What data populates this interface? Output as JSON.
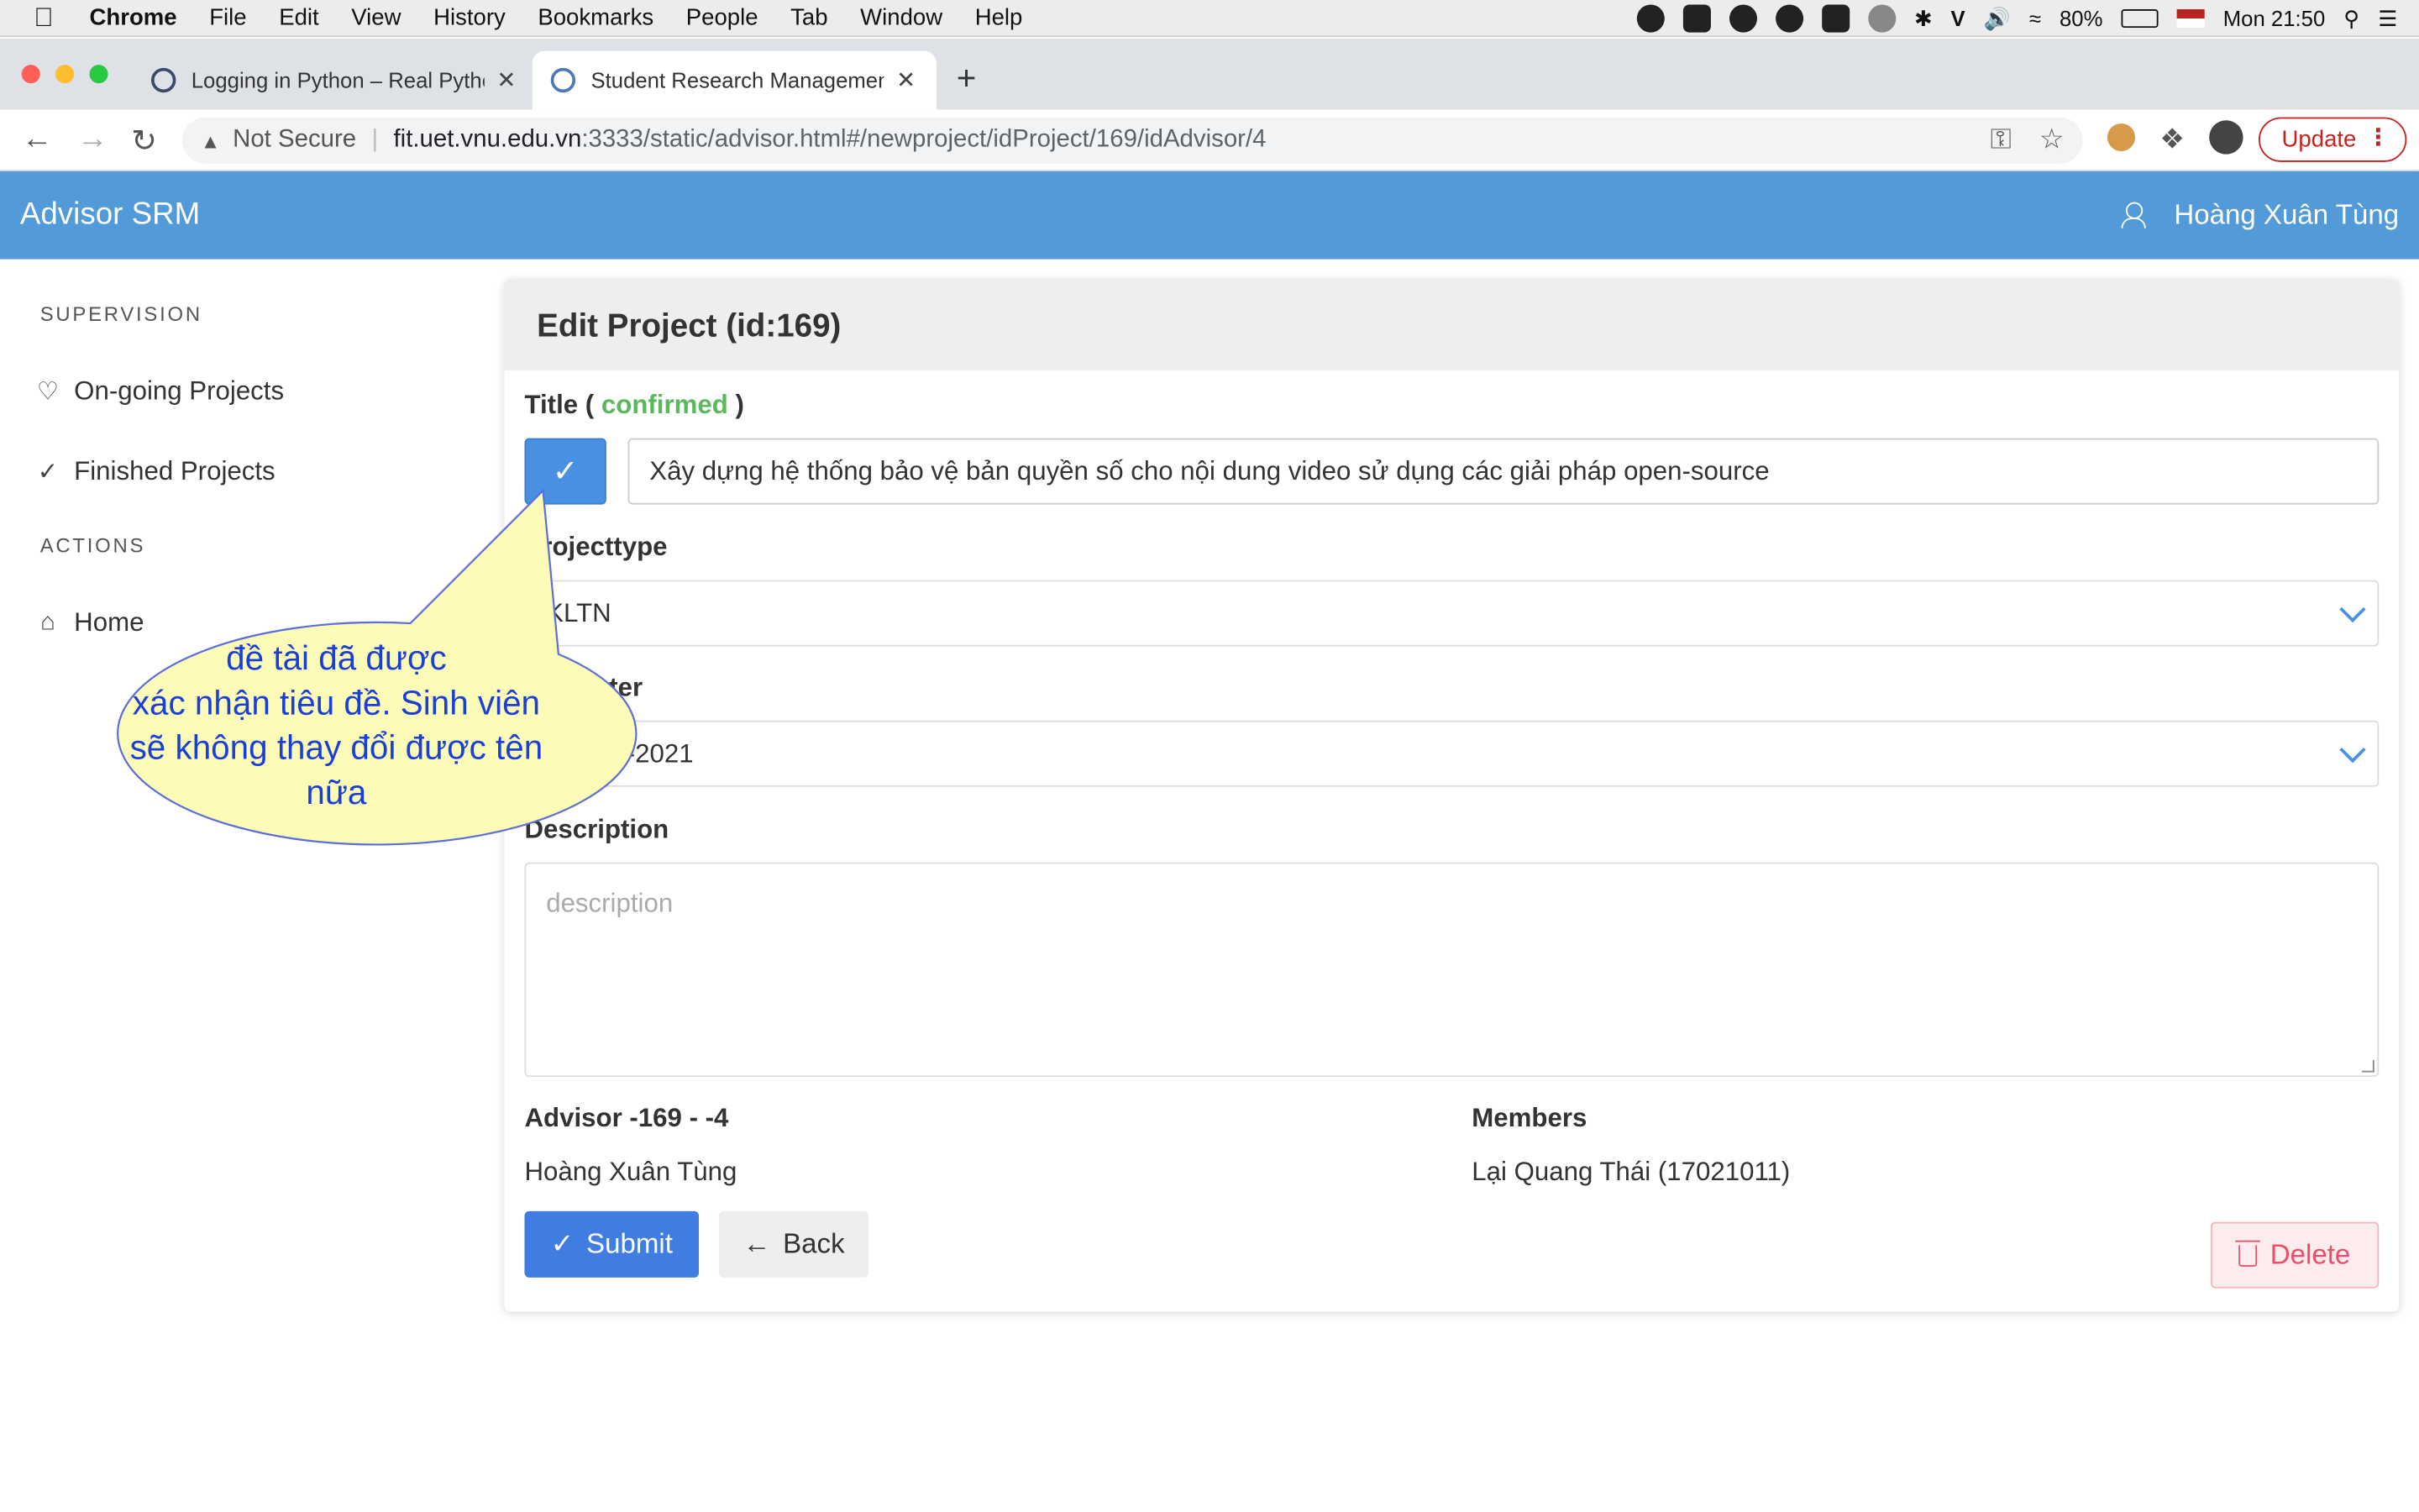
{
  "menubar": {
    "app": "Chrome",
    "items": [
      "File",
      "Edit",
      "View",
      "History",
      "Bookmarks",
      "People",
      "Tab",
      "Window",
      "Help"
    ],
    "battery": "80%",
    "clock": "Mon 21:50"
  },
  "tabs": [
    {
      "label": "Logging in Python – Real Pytho"
    },
    {
      "label": "Student Research Managemen"
    }
  ],
  "address": {
    "security": "Not Secure",
    "host": "fit.uet.vnu.edu.vn",
    "path": ":3333/static/advisor.html#/newproject/idProject/169/idAdvisor/4"
  },
  "update_label": "Update",
  "header": {
    "brand": "Advisor SRM",
    "user": "Hoàng Xuân Tùng"
  },
  "sidebar": {
    "heading_supervision": "SUPERVISION",
    "ongoing": "On-going Projects",
    "finished": "Finished Projects",
    "heading_actions": "ACTIONS",
    "home": "Home"
  },
  "card": {
    "title": "Edit Project (id:169)",
    "title_label": "Title (",
    "title_status": "confirmed",
    "title_label_end": ")",
    "title_value": "Xây dựng hệ thống bảo vệ bản quyền số cho nội dung video sử dụng các giải pháp open-source",
    "projecttype_label": "Projecttype",
    "projecttype_value": "KLTN",
    "semester_label": "Semester",
    "semester_value": "2 2020-2021",
    "description_label": "Description",
    "description_placeholder": "description",
    "advisor_label": "Advisor -169 - -4",
    "advisor_value": "Hoàng Xuân Tùng",
    "members_label": "Members",
    "members_value": "Lại Quang Thái (17021011)",
    "submit": "Submit",
    "back": "Back",
    "delete": "Delete"
  },
  "callout": {
    "line1": "đề tài đã được",
    "line2": "xác nhận tiêu đề. Sinh viên",
    "line3": "sẽ không thay đổi được tên",
    "line4": "nữa",
    "fill": "#fdfbb8",
    "text_color": "#1a3fd6"
  },
  "colors": {
    "header": "#529ad8",
    "submit": "#3f7ee0",
    "confirmed": "#5cb85c",
    "delete": "#e8506a"
  }
}
